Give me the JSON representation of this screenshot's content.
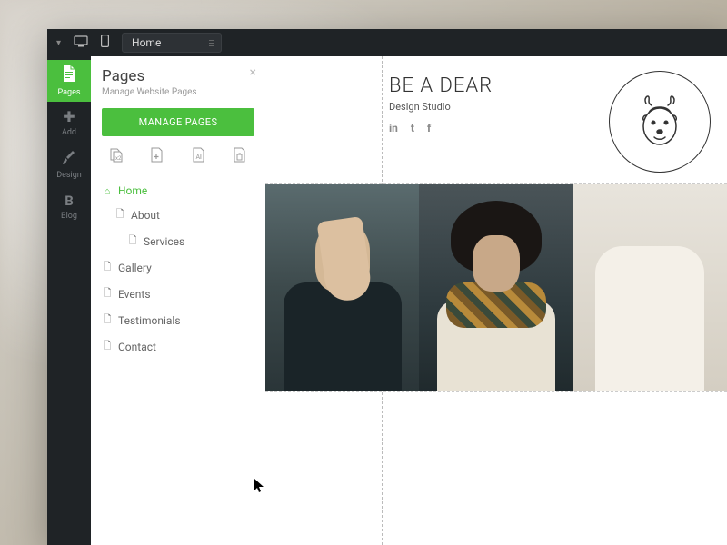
{
  "topbar": {
    "page_selector": "Home"
  },
  "sidebar": {
    "items": [
      {
        "label": "Pages"
      },
      {
        "label": "Add"
      },
      {
        "label": "Design"
      },
      {
        "label": "Blog"
      }
    ]
  },
  "panel": {
    "title": "Pages",
    "subtitle": "Manage Website Pages",
    "manage_button": "MANAGE PAGES",
    "tree": [
      {
        "label": "Home",
        "level": 0,
        "active": true
      },
      {
        "label": "About",
        "level": 1
      },
      {
        "label": "Services",
        "level": 2
      },
      {
        "label": "Gallery",
        "level": 0
      },
      {
        "label": "Events",
        "level": 0
      },
      {
        "label": "Testimonials",
        "level": 0
      },
      {
        "label": "Contact",
        "level": 0
      }
    ]
  },
  "site": {
    "title": "BE A DEAR",
    "tagline": "Design Studio",
    "social": [
      "in",
      "t",
      "f"
    ]
  },
  "colors": {
    "accent": "#4bbf3e",
    "dark": "#1f2326"
  }
}
